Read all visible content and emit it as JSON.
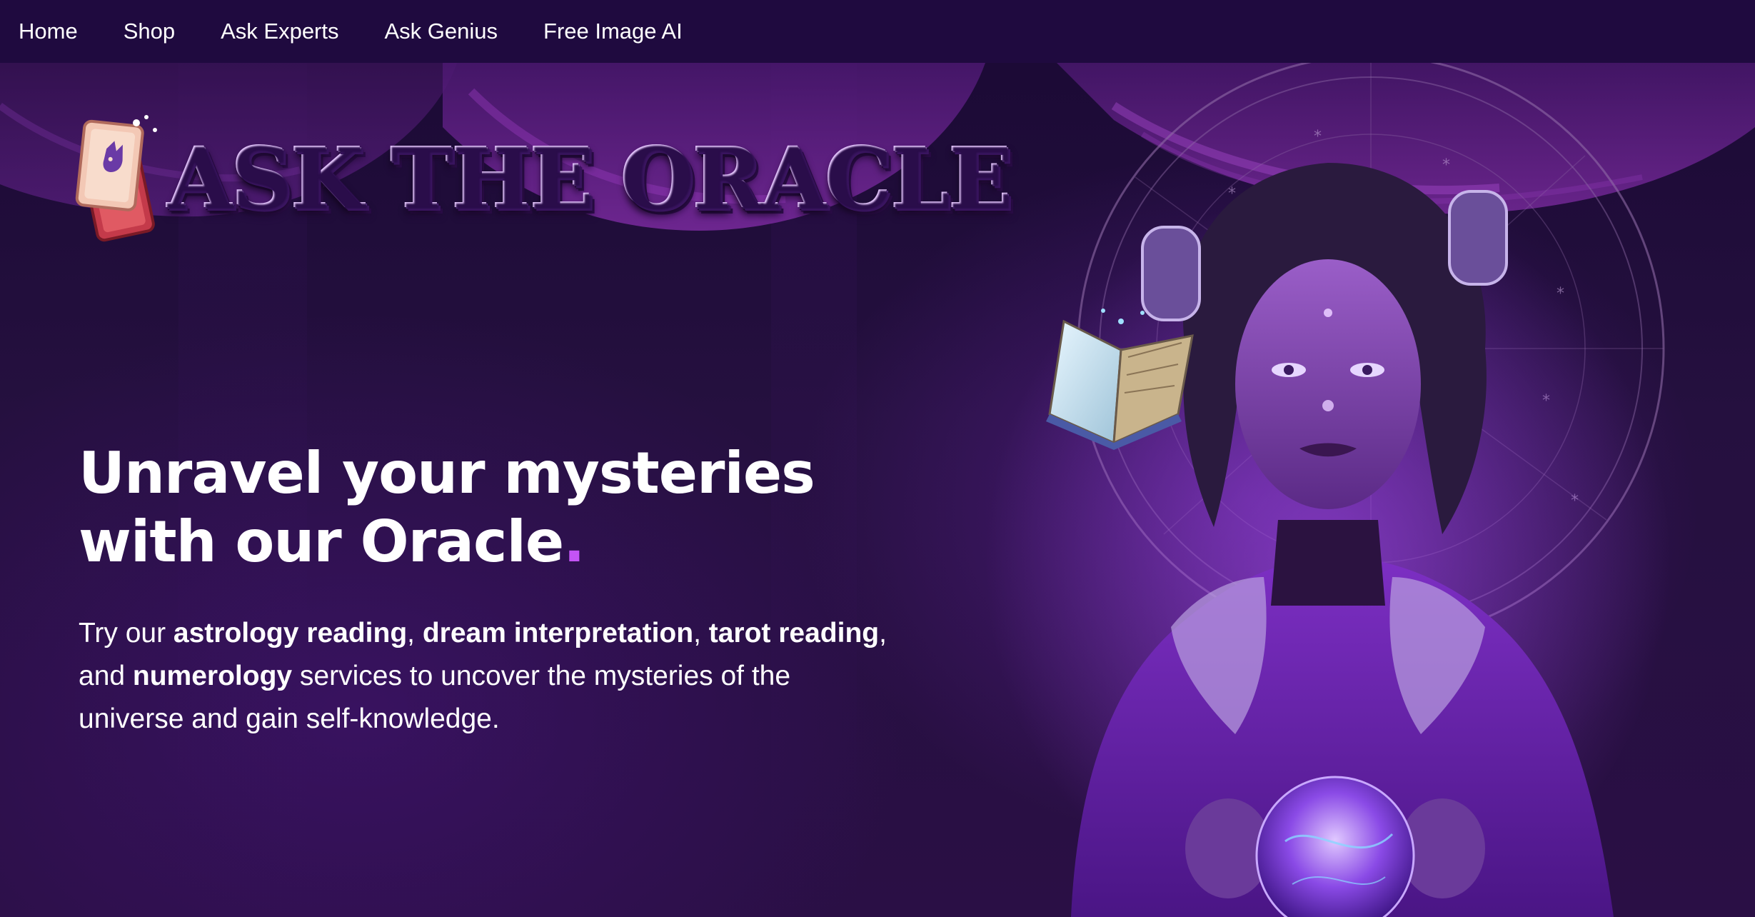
{
  "nav": {
    "items": [
      {
        "label": "Home"
      },
      {
        "label": "Shop"
      },
      {
        "label": "Ask Experts"
      },
      {
        "label": "Ask Genius"
      },
      {
        "label": "Free Image AI"
      }
    ]
  },
  "logo": {
    "text": "ASK THE ORACLE",
    "icon": "tarot-cards-icon"
  },
  "hero": {
    "title_line1": "Unravel your mysteries",
    "title_line2": "with our Oracle",
    "title_dot": ".",
    "desc_intro": "Try our ",
    "desc_astrology": "astrology reading",
    "desc_sep1": ", ",
    "desc_dream": "dream interpretation",
    "desc_sep2": ", ",
    "desc_tarot": "tarot reading",
    "desc_sep3": ", and ",
    "desc_numerology": "numerology",
    "desc_outro": " services to uncover the mysteries of the universe and gain self-knowledge."
  },
  "colors": {
    "nav_bg": "#1f0a3f",
    "page_bg": "#1c0a33",
    "accent_dot": "#c454f5",
    "logo_purple": "#b37be8",
    "logo_gold": "#f2b84a"
  },
  "illustration": {
    "icon": "oracle-sorceress-illustration",
    "book_icon": "open-book-icon",
    "orb_icon": "crystal-ball-icon"
  }
}
